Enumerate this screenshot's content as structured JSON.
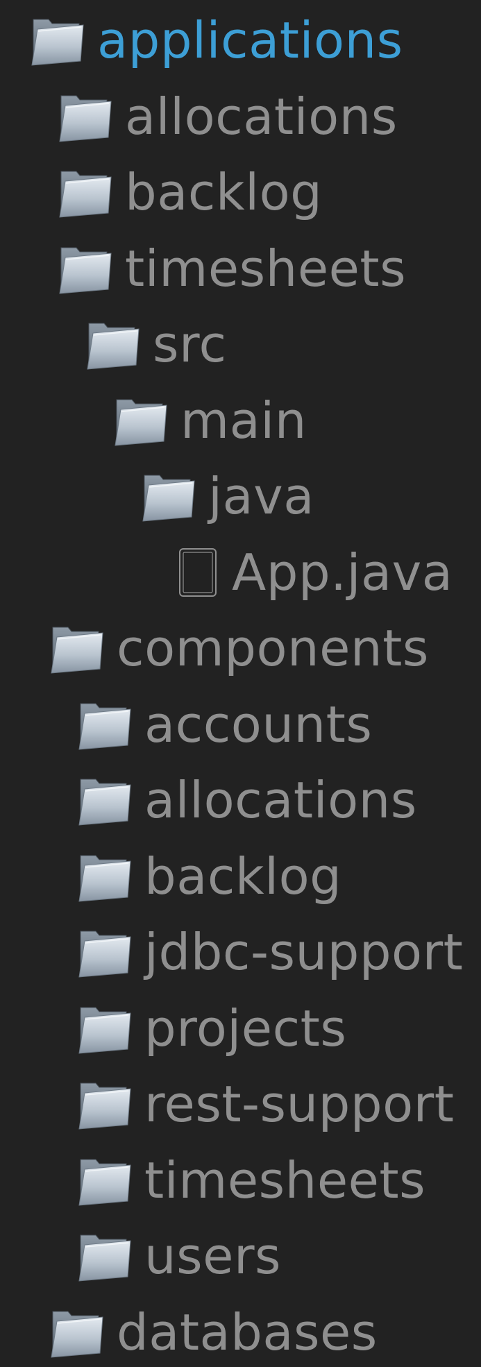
{
  "tree": [
    {
      "name": "applications",
      "type": "folder",
      "depth": 0,
      "active": true
    },
    {
      "name": "allocations",
      "type": "folder",
      "depth": 1
    },
    {
      "name": "backlog",
      "type": "folder",
      "depth": 1
    },
    {
      "name": "timesheets",
      "type": "folder",
      "depth": 1
    },
    {
      "name": "src",
      "type": "folder",
      "depth": 2
    },
    {
      "name": "main",
      "type": "folder",
      "depth": 3
    },
    {
      "name": "java",
      "type": "folder",
      "depth": 4
    },
    {
      "name": "App.java",
      "type": "file",
      "depth": 5
    },
    {
      "name": "components",
      "type": "folder",
      "depth": 0.7
    },
    {
      "name": "accounts",
      "type": "folder",
      "depth": 1.7
    },
    {
      "name": "allocations",
      "type": "folder",
      "depth": 1.7
    },
    {
      "name": "backlog",
      "type": "folder",
      "depth": 1.7
    },
    {
      "name": "jdbc-support",
      "type": "folder",
      "depth": 1.7
    },
    {
      "name": "projects",
      "type": "folder",
      "depth": 1.7
    },
    {
      "name": "rest-support",
      "type": "folder",
      "depth": 1.7
    },
    {
      "name": "timesheets",
      "type": "folder",
      "depth": 1.7
    },
    {
      "name": "users",
      "type": "folder",
      "depth": 1.7
    },
    {
      "name": "databases",
      "type": "folder",
      "depth": 0.7
    }
  ],
  "colors": {
    "background": "#222222",
    "text": "#8f8f8f",
    "active_text": "#3d9fd6"
  },
  "icons": {
    "folder": "folder-icon",
    "file": "file-icon"
  }
}
